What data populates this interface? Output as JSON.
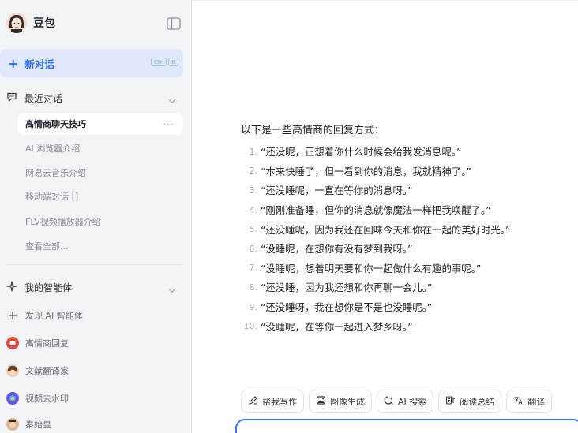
{
  "brand": {
    "name": "豆包"
  },
  "new_chat": {
    "label": "新对话",
    "shortcut": [
      "Ctrl",
      "K"
    ]
  },
  "recent": {
    "title": "最近对话",
    "items": [
      {
        "label": "高情商聊天技巧",
        "active": true,
        "more": "···"
      },
      {
        "label": "AI 浏览器介绍"
      },
      {
        "label": "网易云音乐介绍"
      },
      {
        "label": "移动端对话 🗋"
      },
      {
        "label": "FLV视频播放器介绍"
      },
      {
        "label": "查看全部..."
      }
    ]
  },
  "agents": {
    "title": "我的智能体",
    "items": [
      {
        "label": "发现 AI 智能体",
        "icon": "plus-icon"
      },
      {
        "label": "高情商回复",
        "icon": "agent-red-icon",
        "color": "#e8463f"
      },
      {
        "label": "文献翻译家",
        "icon": "agent-avatar-icon",
        "color": "#c9782c"
      },
      {
        "label": "视频去水印",
        "icon": "agent-purple-icon",
        "color": "#6c4ee6"
      },
      {
        "label": "秦始皇",
        "icon": "agent-emperor-icon",
        "color": "#a86a3a"
      }
    ]
  },
  "message": {
    "intro": "以下是一些高情商的回复方式：",
    "items": [
      "“还没呢，正想着你什么时候会给我发消息呢。”",
      "“本来快睡了，但一看到你的消息，我就精神了。”",
      "“还没睡呢，一直在等你的消息呀。”",
      "“刚刚准备睡，但你的消息就像魔法一样把我唤醒了。”",
      "“还没睡呢，因为我还在回味今天和你在一起的美好时光。”",
      "“没睡呢，在想你有没有梦到我呀。”",
      "“没睡呢，想着明天要和你一起做什么有趣的事呢。”",
      "“还没睡，因为我还想和你再聊一会儿。”",
      "“还没睡呀，我在想你是不是也没睡呢。”",
      "“没睡呢，在等你一起进入梦乡呀。”"
    ]
  },
  "tools": [
    {
      "label": "帮我写作",
      "icon": "pen-icon"
    },
    {
      "label": "图像生成",
      "icon": "image-icon"
    },
    {
      "label": "AI 搜索",
      "icon": "search-icon"
    },
    {
      "label": "阅读总结",
      "icon": "read-icon"
    },
    {
      "label": "翻译",
      "icon": "translate-icon"
    }
  ],
  "colors": {
    "accent": "#2f6df6",
    "sidebar_bg": "#f3f4f6",
    "new_chat_bg": "#dfe9fb"
  }
}
